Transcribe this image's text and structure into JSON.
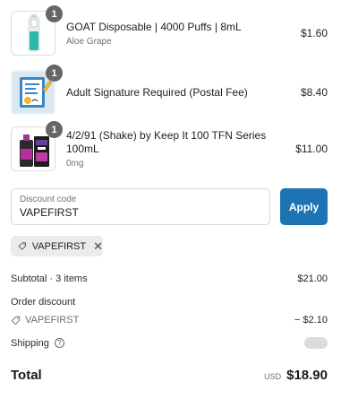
{
  "items": [
    {
      "quantity": "1",
      "name": "GOAT Disposable | 4000 Puffs | 8mL",
      "variant": "Aloe Grape",
      "price": "$1.60",
      "image_icon": "vape-device-icon"
    },
    {
      "quantity": "1",
      "name": "Adult Signature Required (Postal Fee)",
      "variant": "",
      "price": "$8.40",
      "image_icon": "signature-document-icon"
    },
    {
      "quantity": "1",
      "name": "4/2/91 (Shake) by Keep It 100 TFN Series 100mL",
      "variant": "0mg",
      "price": "$11.00",
      "image_icon": "eliquid-bottle-icon"
    }
  ],
  "discount": {
    "label": "Discount code",
    "value": "VAPEFIRST",
    "apply_label": "Apply",
    "applied_code": "VAPEFIRST"
  },
  "summary": {
    "subtotal_label": "Subtotal · 3 items",
    "subtotal_value": "$21.00",
    "order_discount_label": "Order discount",
    "discount_code": "VAPEFIRST",
    "discount_value": "− $2.10",
    "shipping_label": "Shipping",
    "total_label": "Total",
    "currency": "USD",
    "total_value": "$18.90"
  },
  "colors": {
    "accent": "#1e73b4",
    "badge": "#666666"
  }
}
